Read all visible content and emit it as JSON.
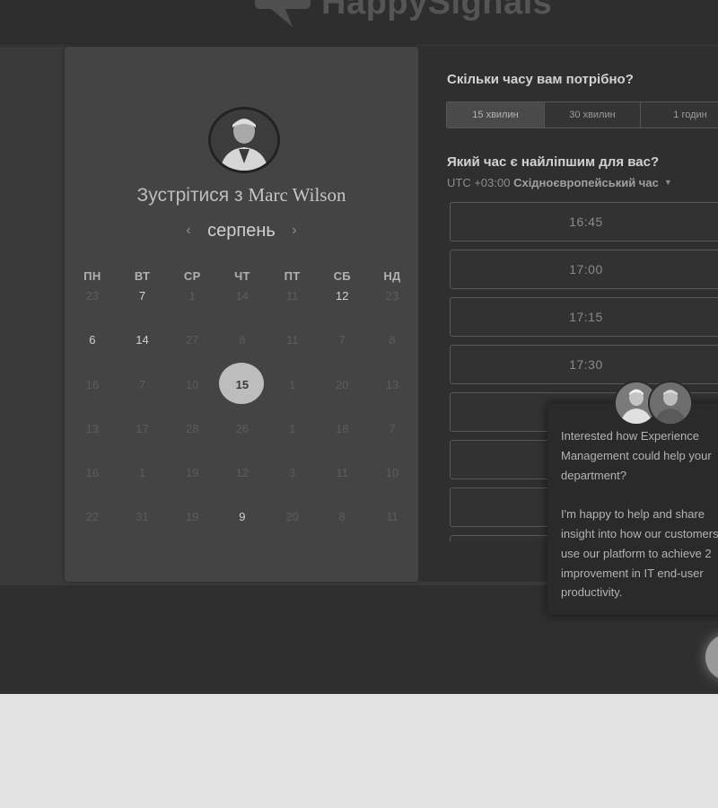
{
  "header": {
    "brand": "HappySignals"
  },
  "booking": {
    "meet_prefix": "Зустрітися з ",
    "host_name": "Marc Wilson",
    "month": "серпень",
    "prev_month_icon": "chevron-left-icon",
    "next_month_icon": "chevron-right-icon",
    "weekdays": [
      "ПН",
      "ВТ",
      "СР",
      "ЧТ",
      "ПТ",
      "СБ",
      "НД"
    ],
    "days": [
      [
        "23",
        "7",
        "1",
        "14",
        "11",
        "12",
        "23"
      ],
      [
        "6",
        "14",
        "27",
        "8",
        "11",
        "7",
        "8"
      ],
      [
        "16",
        "7",
        "10",
        "15",
        "1",
        "20",
        "13"
      ],
      [
        "13",
        "17",
        "28",
        "26",
        "1",
        "18",
        "7"
      ],
      [
        "16",
        "1",
        "19",
        "12",
        "3",
        "11",
        "10"
      ],
      [
        "22",
        "31",
        "19",
        "9",
        "20",
        "8",
        "11"
      ]
    ],
    "available_days": [
      [
        0,
        1
      ],
      [
        0,
        5
      ],
      [
        1,
        0
      ],
      [
        1,
        1
      ],
      [
        5,
        3
      ]
    ],
    "selected_day": [
      2,
      3
    ]
  },
  "scheduler": {
    "duration_question": "Скільки часу вам потрібно?",
    "durations": [
      "15 хвилин",
      "30 хвилин",
      "1 годин"
    ],
    "active_duration": 0,
    "time_question": "Який час є найліпшим для вас?",
    "tz_offset": "UTC +03:00",
    "tz_name": "Східноєвропейський час",
    "times": [
      "16:45",
      "17:00",
      "17:15",
      "17:30",
      "",
      "",
      "",
      ""
    ]
  },
  "chat": {
    "message": "Interested how Experience Management could help your department?\n\nI'm happy to help and share insight into how our customers use our platform to achieve 2 improvement in IT end-user productivity."
  }
}
